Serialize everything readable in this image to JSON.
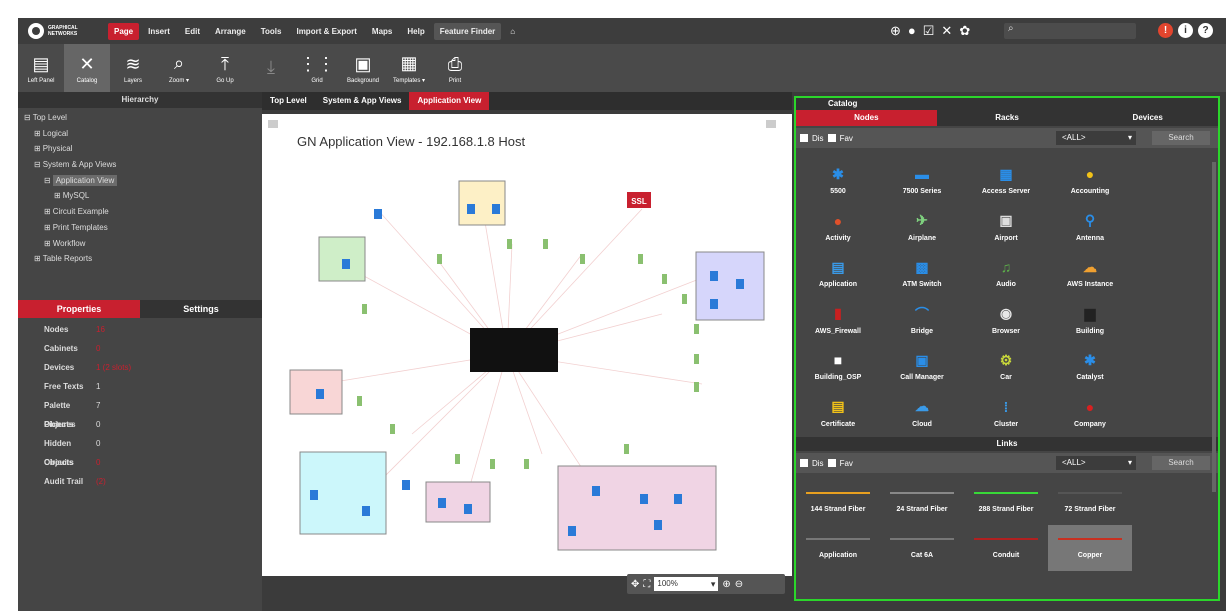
{
  "app": {
    "logo_text": "GRAPHICAL NETWORKS"
  },
  "menu": {
    "items": [
      {
        "label": "Page",
        "active": true
      },
      {
        "label": "Insert"
      },
      {
        "label": "Edit"
      },
      {
        "label": "Arrange"
      },
      {
        "label": "Tools"
      },
      {
        "label": "Import & Export"
      },
      {
        "label": "Maps"
      },
      {
        "label": "Help"
      },
      {
        "label": "Feature Finder"
      }
    ],
    "right_icons": [
      "globe-icon",
      "circle-icon",
      "edit-icon",
      "tools-icon",
      "gear-icon"
    ],
    "search_glyph": "⌕",
    "alerts": [
      "!",
      "i",
      "?"
    ]
  },
  "toolbar": {
    "tools": [
      {
        "label": "Left Panel",
        "icon": "▤"
      },
      {
        "label": "Catalog",
        "icon": "✕"
      },
      {
        "label": "Layers",
        "icon": "≋"
      },
      {
        "label": "Zoom ▾",
        "icon": "⌕"
      },
      {
        "label": "Go Up",
        "icon": "⤒"
      },
      {
        "label": "",
        "icon": "⤓"
      },
      {
        "label": "Grid",
        "icon": "⋮⋮"
      },
      {
        "label": "Background",
        "icon": "▣"
      },
      {
        "label": "Templates ▾",
        "icon": "▦"
      },
      {
        "label": "Print",
        "icon": "⎙"
      }
    ]
  },
  "left": {
    "hierarchy_title": "Hierarchy",
    "tree": [
      {
        "label": "Top Level",
        "indent": 0,
        "pre": "⊟"
      },
      {
        "label": "Logical",
        "indent": 1,
        "pre": "⊞"
      },
      {
        "label": "Physical",
        "indent": 1,
        "pre": "⊞"
      },
      {
        "label": "System & App Views",
        "indent": 1,
        "pre": "⊟"
      },
      {
        "label": "Application View",
        "indent": 2,
        "pre": "⊟",
        "sel": true
      },
      {
        "label": "MySQL",
        "indent": 3,
        "pre": "⊞"
      },
      {
        "label": "Circuit Example",
        "indent": 2,
        "pre": "⊞"
      },
      {
        "label": "Print Templates",
        "indent": 2,
        "pre": "⊞"
      },
      {
        "label": "Workflow",
        "indent": 2,
        "pre": "⊞"
      },
      {
        "label": "Table Reports",
        "indent": 1,
        "pre": "⊞"
      }
    ],
    "tab_properties": "Properties",
    "tab_settings": "Settings",
    "props": [
      {
        "k": "Nodes",
        "v": "16",
        "red": true
      },
      {
        "k": "Cabinets",
        "v": "0",
        "red": true
      },
      {
        "k": "Devices",
        "v": "1 (2 slots)",
        "red": true
      },
      {
        "k": "Free Texts",
        "v": "1"
      },
      {
        "k": "Palette Objects",
        "v": "7"
      },
      {
        "k": "Pictures",
        "v": "0"
      },
      {
        "k": "Hidden Objects",
        "v": "0"
      },
      {
        "k": "Circuits",
        "v": "0",
        "red": true
      },
      {
        "k": "Audit Trail",
        "v": "(2)",
        "red": true
      }
    ]
  },
  "center": {
    "tabs": [
      {
        "label": "Top Level"
      },
      {
        "label": "System & App Views"
      },
      {
        "label": "Application View",
        "on": true
      }
    ],
    "canvas_title": "GN Application View - 192.168.1.8 Host",
    "ssl_label": "SSL",
    "zoom_value": "100%"
  },
  "catalog": {
    "title": "Catalog",
    "tabs": [
      {
        "label": "Nodes",
        "on": true
      },
      {
        "label": "Racks"
      },
      {
        "label": "Devices"
      }
    ],
    "filter1": "Dis",
    "filter2": "Fav",
    "filter_select": "<ALL>",
    "search_label": "Search",
    "nodes": [
      {
        "label": "5500",
        "color": "#2a8ee8",
        "glyph": "✱"
      },
      {
        "label": "7500 Series",
        "color": "#2a8ee8",
        "glyph": "▬"
      },
      {
        "label": "Access Server",
        "color": "#2a8ee8",
        "glyph": "▦"
      },
      {
        "label": "Accounting",
        "color": "#f2c218",
        "glyph": "●"
      },
      {
        "label": "Activity",
        "color": "#e0502a",
        "glyph": "●"
      },
      {
        "label": "Airplane",
        "color": "#7fd27f",
        "glyph": "✈"
      },
      {
        "label": "Airport",
        "color": "#ddd",
        "glyph": "▣"
      },
      {
        "label": "Antenna",
        "color": "#2a8ee8",
        "glyph": "⚲"
      },
      {
        "label": "Application",
        "color": "#3a9ae8",
        "glyph": "▤"
      },
      {
        "label": "ATM Switch",
        "color": "#2a8ee8",
        "glyph": "▩"
      },
      {
        "label": "Audio",
        "color": "#5cae4a",
        "glyph": "♫"
      },
      {
        "label": "AWS Instance",
        "color": "#f0a030",
        "glyph": "☁"
      },
      {
        "label": "AWS_Firewall",
        "color": "#c82020",
        "glyph": "▮"
      },
      {
        "label": "Bridge",
        "color": "#2a8ee8",
        "glyph": "⌒"
      },
      {
        "label": "Browser",
        "color": "#e8e8e8",
        "glyph": "◉"
      },
      {
        "label": "Building",
        "color": "#222",
        "glyph": "▆"
      },
      {
        "label": "Building_OSP",
        "color": "#fff",
        "glyph": "■"
      },
      {
        "label": "Call Manager",
        "color": "#2a8ee8",
        "glyph": "▣"
      },
      {
        "label": "Car",
        "color": "#c8d83a",
        "glyph": "⚙"
      },
      {
        "label": "Catalyst",
        "color": "#2a8ee8",
        "glyph": "✱"
      },
      {
        "label": "Certificate",
        "color": "#f2c218",
        "glyph": "▤"
      },
      {
        "label": "Cloud",
        "color": "#3a9ae8",
        "glyph": "☁"
      },
      {
        "label": "Cluster",
        "color": "#3a9ae8",
        "glyph": "⁞"
      },
      {
        "label": "Company",
        "color": "#d82020",
        "glyph": "●"
      }
    ],
    "links_title": "Links",
    "links": [
      {
        "label": "144 Strand Fiber",
        "color": "#e8a020"
      },
      {
        "label": "24 Strand Fiber",
        "color": "#888"
      },
      {
        "label": "288 Strand Fiber",
        "color": "#38d838"
      },
      {
        "label": "72 Strand Fiber",
        "color": "#555"
      },
      {
        "label": "Application",
        "color": "#777"
      },
      {
        "label": "Cat 6A",
        "color": "#777"
      },
      {
        "label": "Conduit",
        "color": "#b02020"
      },
      {
        "label": "Copper",
        "color": "#c83020",
        "sel": true
      }
    ]
  }
}
